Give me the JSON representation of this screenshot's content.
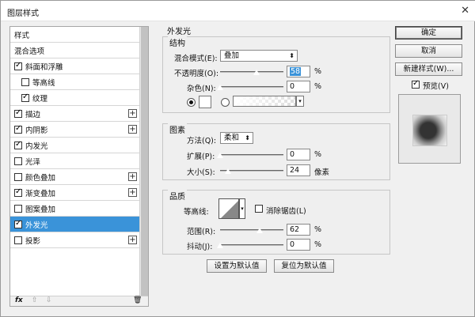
{
  "window": {
    "title": "图层样式"
  },
  "sidebar": {
    "items": [
      {
        "label": "样式",
        "check": "none",
        "plus": false,
        "indent": false,
        "selected": false
      },
      {
        "label": "混合选项",
        "check": "none",
        "plus": false,
        "indent": false,
        "selected": false
      },
      {
        "label": "斜面和浮雕",
        "check": "on",
        "plus": false,
        "indent": false,
        "selected": false
      },
      {
        "label": "等高线",
        "check": "off",
        "plus": false,
        "indent": true,
        "selected": false
      },
      {
        "label": "纹理",
        "check": "on",
        "plus": false,
        "indent": true,
        "selected": false
      },
      {
        "label": "描边",
        "check": "on",
        "plus": true,
        "indent": false,
        "selected": false
      },
      {
        "label": "内阴影",
        "check": "on",
        "plus": true,
        "indent": false,
        "selected": false
      },
      {
        "label": "内发光",
        "check": "on",
        "plus": false,
        "indent": false,
        "selected": false
      },
      {
        "label": "光泽",
        "check": "off",
        "plus": false,
        "indent": false,
        "selected": false
      },
      {
        "label": "颜色叠加",
        "check": "off",
        "plus": true,
        "indent": false,
        "selected": false
      },
      {
        "label": "渐变叠加",
        "check": "on",
        "plus": true,
        "indent": false,
        "selected": false
      },
      {
        "label": "图案叠加",
        "check": "off",
        "plus": false,
        "indent": false,
        "selected": false
      },
      {
        "label": "外发光",
        "check": "on",
        "plus": false,
        "indent": false,
        "selected": true
      },
      {
        "label": "投影",
        "check": "off",
        "plus": true,
        "indent": false,
        "selected": false
      }
    ],
    "footer": {
      "fx": "fx",
      "up": "⇧",
      "down": "⇩",
      "trash": "🗑"
    }
  },
  "panel": {
    "title": "外发光",
    "structure": {
      "title": "结构",
      "blend_mode_label": "混合模式(E):",
      "blend_mode_value": "叠加",
      "opacity_label": "不透明度(O):",
      "opacity_value": "58",
      "opacity_unit": "%",
      "noise_label": "杂色(N):",
      "noise_value": "0",
      "noise_unit": "%",
      "color_swatch": "#ffffff"
    },
    "elements": {
      "title": "图素",
      "technique_label": "方法(Q):",
      "technique_value": "柔和",
      "spread_label": "扩展(P):",
      "spread_value": "0",
      "spread_unit": "%",
      "size_label": "大小(S):",
      "size_value": "24",
      "size_unit": "像素"
    },
    "quality": {
      "title": "品质",
      "contour_label": "等高线:",
      "antialias_label": "消除锯齿(L)",
      "range_label": "范围(R):",
      "range_value": "62",
      "range_unit": "%",
      "jitter_label": "抖动(J):",
      "jitter_value": "0",
      "jitter_unit": "%"
    },
    "buttons": {
      "make_default": "设置为默认值",
      "reset_default": "复位为默认值"
    }
  },
  "right": {
    "ok": "确定",
    "cancel": "取消",
    "new_style": "新建样式(W)...",
    "preview_label": "预览(V)"
  },
  "sliders": {
    "opacity": 0.58,
    "noise": 0.0,
    "spread": 0.0,
    "size": 0.12,
    "range": 0.62,
    "jitter": 0.0
  }
}
